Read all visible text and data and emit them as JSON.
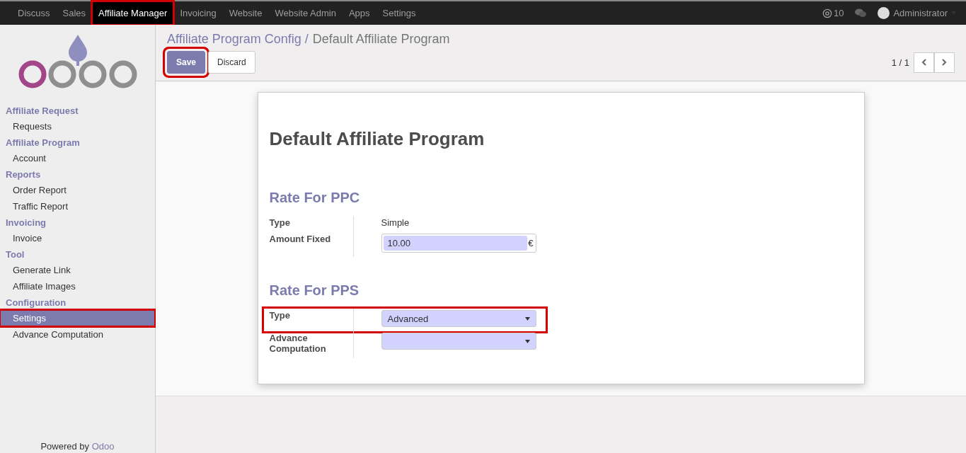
{
  "top_menu": [
    {
      "label": "Discuss",
      "selected": false,
      "highlighted": false
    },
    {
      "label": "Sales",
      "selected": false,
      "highlighted": false
    },
    {
      "label": "Affiliate Manager",
      "selected": true,
      "highlighted": true
    },
    {
      "label": "Invoicing",
      "selected": false,
      "highlighted": false
    },
    {
      "label": "Website",
      "selected": false,
      "highlighted": false
    },
    {
      "label": "Website Admin",
      "selected": false,
      "highlighted": false
    },
    {
      "label": "Apps",
      "selected": false,
      "highlighted": false
    },
    {
      "label": "Settings",
      "selected": false,
      "highlighted": false
    }
  ],
  "systray": {
    "mentions": "10",
    "user": "Administrator"
  },
  "sidebar": {
    "sections": [
      {
        "title": "Affiliate Request",
        "items": [
          {
            "label": "Requests",
            "selected": false,
            "highlighted": false
          }
        ]
      },
      {
        "title": "Affiliate Program",
        "items": [
          {
            "label": "Account",
            "selected": false,
            "highlighted": false
          }
        ]
      },
      {
        "title": "Reports",
        "items": [
          {
            "label": "Order Report",
            "selected": false,
            "highlighted": false
          },
          {
            "label": "Traffic Report",
            "selected": false,
            "highlighted": false
          }
        ]
      },
      {
        "title": "Invoicing",
        "items": [
          {
            "label": "Invoice",
            "selected": false,
            "highlighted": false
          }
        ]
      },
      {
        "title": "Tool",
        "items": [
          {
            "label": "Generate Link",
            "selected": false,
            "highlighted": false
          },
          {
            "label": "Affiliate Images",
            "selected": false,
            "highlighted": false
          }
        ]
      },
      {
        "title": "Configuration",
        "items": [
          {
            "label": "Settings",
            "selected": true,
            "highlighted": true
          },
          {
            "label": "Advance Computation",
            "selected": false,
            "highlighted": false
          }
        ]
      }
    ],
    "footer_prefix": "Powered by",
    "footer_brand": "Odoo"
  },
  "breadcrumb": {
    "parent": "Affiliate Program Config /",
    "current": "Default Affiliate Program"
  },
  "buttons": [
    {
      "label": "Save",
      "kind": "primary",
      "highlighted": true
    },
    {
      "label": "Discard",
      "kind": "secondary",
      "highlighted": false
    }
  ],
  "pager": {
    "text": "1 / 1"
  },
  "form": {
    "title": "Default Affiliate Program",
    "groups": [
      {
        "title": "Rate For PPC",
        "fields": [
          {
            "label": "Type",
            "kind": "text",
            "value": "Simple",
            "highlighted": false
          },
          {
            "label": "Amount Fixed",
            "kind": "money",
            "value": "10.00",
            "currency": "€",
            "highlighted": false
          }
        ]
      },
      {
        "title": "Rate For PPS",
        "fields": [
          {
            "label": "Type",
            "kind": "select",
            "value": "Advanced",
            "highlighted": true
          },
          {
            "label": "Advance Computation",
            "kind": "select",
            "highlighted": false
          }
        ]
      }
    ]
  }
}
